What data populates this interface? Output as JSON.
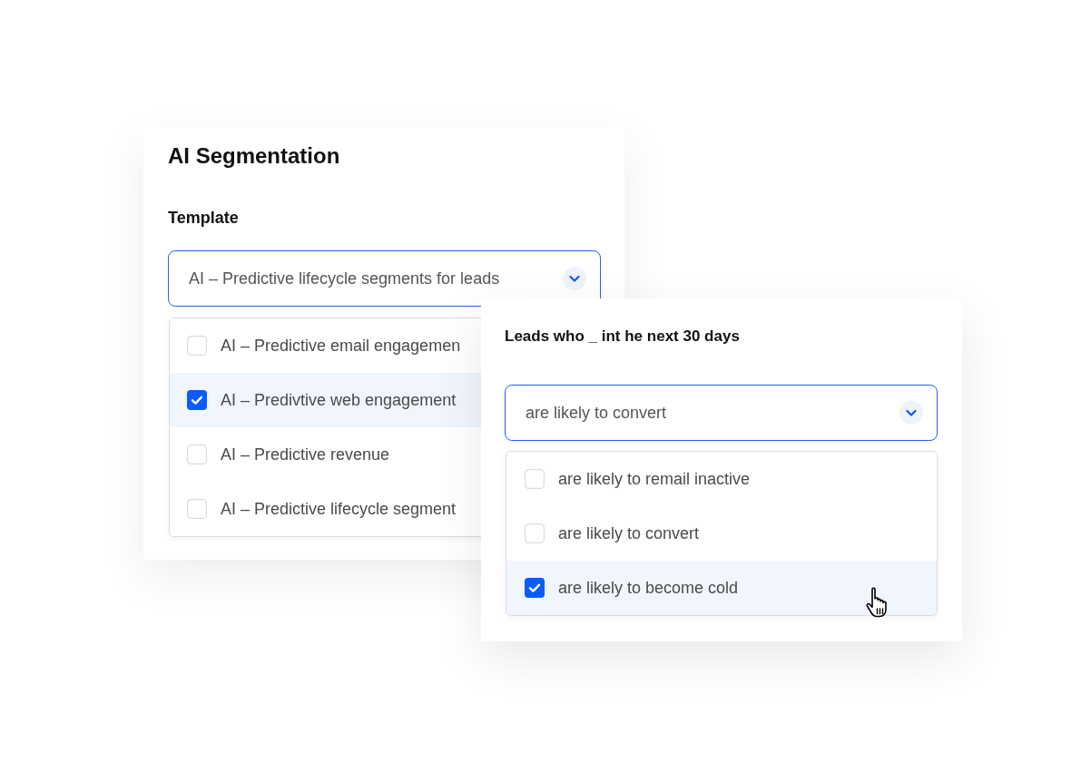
{
  "segmentation_card": {
    "title": "AI Segmentation",
    "field_label": "Template",
    "dropdown": {
      "value": "AI – Predictive lifecycle segments for leads"
    },
    "options": [
      {
        "label": "AI – Predictive email engagemen",
        "checked": false
      },
      {
        "label": "AI – Predivtive web engagement",
        "checked": true
      },
      {
        "label": "AI – Predictive revenue",
        "checked": false
      },
      {
        "label": "AI – Predictive lifecycle segment",
        "checked": false
      }
    ]
  },
  "condition_card": {
    "title": "Leads who _ int he next 30 days",
    "dropdown": {
      "value": "are likely to convert"
    },
    "options": [
      {
        "label": "are likely to remail inactive",
        "checked": false
      },
      {
        "label": "are likely to convert",
        "checked": false
      },
      {
        "label": "are likely to become cold",
        "checked": true
      }
    ]
  }
}
